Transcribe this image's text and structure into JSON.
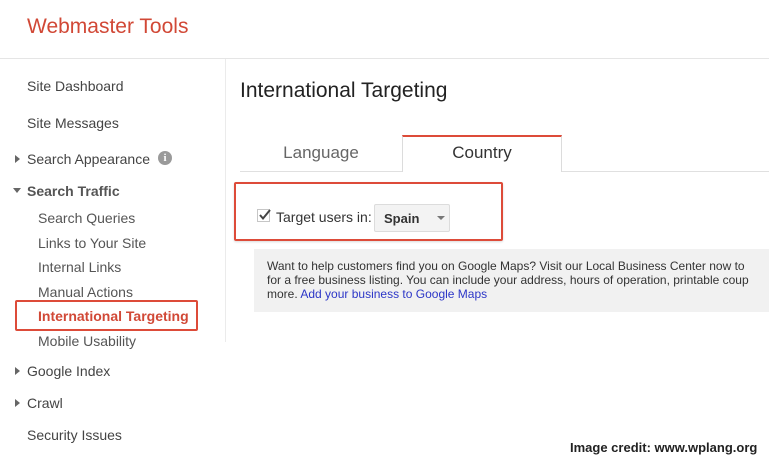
{
  "app": {
    "title": "Webmaster Tools"
  },
  "sidebar": {
    "site_dashboard": "Site Dashboard",
    "site_messages": "Site Messages",
    "search_appearance": "Search Appearance",
    "info_icon_glyph": "i",
    "search_traffic": "Search Traffic",
    "search_queries": "Search Queries",
    "links_to_site": "Links to Your Site",
    "internal_links": "Internal Links",
    "manual_actions": "Manual Actions",
    "international_targeting": "International Targeting",
    "mobile_usability": "Mobile Usability",
    "google_index": "Google Index",
    "crawl": "Crawl",
    "security_issues": "Security Issues"
  },
  "main": {
    "title": "International Targeting",
    "tabs": [
      {
        "label": "Language",
        "selected": false
      },
      {
        "label": "Country",
        "selected": true
      }
    ],
    "target": {
      "label": "Target users in:",
      "checked": true,
      "selected_country": "Spain"
    },
    "info": {
      "line1": "Want to help customers find you on Google Maps? Visit our Local Business Center now to",
      "line2": "for a free business listing. You can include your address, hours of operation, printable coup",
      "line3_prefix": "more. ",
      "link": "Add your business to Google Maps"
    }
  },
  "credit": "Image credit: www.wplang.org",
  "colors": {
    "brand": "#d14836",
    "highlight_border": "#dd4b39",
    "link": "#2c36c7",
    "panel_bg": "#f1f1f1"
  }
}
